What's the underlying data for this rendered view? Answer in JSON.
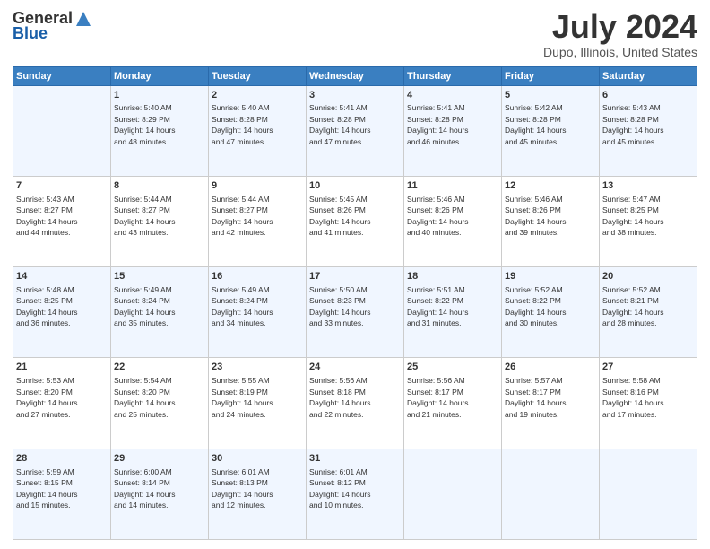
{
  "header": {
    "logo_general": "General",
    "logo_blue": "Blue",
    "main_title": "July 2024",
    "subtitle": "Dupo, Illinois, United States"
  },
  "columns": [
    "Sunday",
    "Monday",
    "Tuesday",
    "Wednesday",
    "Thursday",
    "Friday",
    "Saturday"
  ],
  "weeks": [
    [
      {
        "day": "",
        "info": ""
      },
      {
        "day": "1",
        "info": "Sunrise: 5:40 AM\nSunset: 8:29 PM\nDaylight: 14 hours\nand 48 minutes."
      },
      {
        "day": "2",
        "info": "Sunrise: 5:40 AM\nSunset: 8:28 PM\nDaylight: 14 hours\nand 47 minutes."
      },
      {
        "day": "3",
        "info": "Sunrise: 5:41 AM\nSunset: 8:28 PM\nDaylight: 14 hours\nand 47 minutes."
      },
      {
        "day": "4",
        "info": "Sunrise: 5:41 AM\nSunset: 8:28 PM\nDaylight: 14 hours\nand 46 minutes."
      },
      {
        "day": "5",
        "info": "Sunrise: 5:42 AM\nSunset: 8:28 PM\nDaylight: 14 hours\nand 45 minutes."
      },
      {
        "day": "6",
        "info": "Sunrise: 5:43 AM\nSunset: 8:28 PM\nDaylight: 14 hours\nand 45 minutes."
      }
    ],
    [
      {
        "day": "7",
        "info": "Sunrise: 5:43 AM\nSunset: 8:27 PM\nDaylight: 14 hours\nand 44 minutes."
      },
      {
        "day": "8",
        "info": "Sunrise: 5:44 AM\nSunset: 8:27 PM\nDaylight: 14 hours\nand 43 minutes."
      },
      {
        "day": "9",
        "info": "Sunrise: 5:44 AM\nSunset: 8:27 PM\nDaylight: 14 hours\nand 42 minutes."
      },
      {
        "day": "10",
        "info": "Sunrise: 5:45 AM\nSunset: 8:26 PM\nDaylight: 14 hours\nand 41 minutes."
      },
      {
        "day": "11",
        "info": "Sunrise: 5:46 AM\nSunset: 8:26 PM\nDaylight: 14 hours\nand 40 minutes."
      },
      {
        "day": "12",
        "info": "Sunrise: 5:46 AM\nSunset: 8:26 PM\nDaylight: 14 hours\nand 39 minutes."
      },
      {
        "day": "13",
        "info": "Sunrise: 5:47 AM\nSunset: 8:25 PM\nDaylight: 14 hours\nand 38 minutes."
      }
    ],
    [
      {
        "day": "14",
        "info": "Sunrise: 5:48 AM\nSunset: 8:25 PM\nDaylight: 14 hours\nand 36 minutes."
      },
      {
        "day": "15",
        "info": "Sunrise: 5:49 AM\nSunset: 8:24 PM\nDaylight: 14 hours\nand 35 minutes."
      },
      {
        "day": "16",
        "info": "Sunrise: 5:49 AM\nSunset: 8:24 PM\nDaylight: 14 hours\nand 34 minutes."
      },
      {
        "day": "17",
        "info": "Sunrise: 5:50 AM\nSunset: 8:23 PM\nDaylight: 14 hours\nand 33 minutes."
      },
      {
        "day": "18",
        "info": "Sunrise: 5:51 AM\nSunset: 8:22 PM\nDaylight: 14 hours\nand 31 minutes."
      },
      {
        "day": "19",
        "info": "Sunrise: 5:52 AM\nSunset: 8:22 PM\nDaylight: 14 hours\nand 30 minutes."
      },
      {
        "day": "20",
        "info": "Sunrise: 5:52 AM\nSunset: 8:21 PM\nDaylight: 14 hours\nand 28 minutes."
      }
    ],
    [
      {
        "day": "21",
        "info": "Sunrise: 5:53 AM\nSunset: 8:20 PM\nDaylight: 14 hours\nand 27 minutes."
      },
      {
        "day": "22",
        "info": "Sunrise: 5:54 AM\nSunset: 8:20 PM\nDaylight: 14 hours\nand 25 minutes."
      },
      {
        "day": "23",
        "info": "Sunrise: 5:55 AM\nSunset: 8:19 PM\nDaylight: 14 hours\nand 24 minutes."
      },
      {
        "day": "24",
        "info": "Sunrise: 5:56 AM\nSunset: 8:18 PM\nDaylight: 14 hours\nand 22 minutes."
      },
      {
        "day": "25",
        "info": "Sunrise: 5:56 AM\nSunset: 8:17 PM\nDaylight: 14 hours\nand 21 minutes."
      },
      {
        "day": "26",
        "info": "Sunrise: 5:57 AM\nSunset: 8:17 PM\nDaylight: 14 hours\nand 19 minutes."
      },
      {
        "day": "27",
        "info": "Sunrise: 5:58 AM\nSunset: 8:16 PM\nDaylight: 14 hours\nand 17 minutes."
      }
    ],
    [
      {
        "day": "28",
        "info": "Sunrise: 5:59 AM\nSunset: 8:15 PM\nDaylight: 14 hours\nand 15 minutes."
      },
      {
        "day": "29",
        "info": "Sunrise: 6:00 AM\nSunset: 8:14 PM\nDaylight: 14 hours\nand 14 minutes."
      },
      {
        "day": "30",
        "info": "Sunrise: 6:01 AM\nSunset: 8:13 PM\nDaylight: 14 hours\nand 12 minutes."
      },
      {
        "day": "31",
        "info": "Sunrise: 6:01 AM\nSunset: 8:12 PM\nDaylight: 14 hours\nand 10 minutes."
      },
      {
        "day": "",
        "info": ""
      },
      {
        "day": "",
        "info": ""
      },
      {
        "day": "",
        "info": ""
      }
    ]
  ]
}
